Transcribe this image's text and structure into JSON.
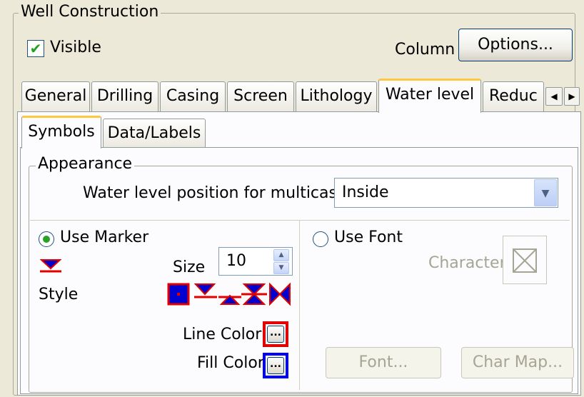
{
  "group": {
    "title": "Well Construction"
  },
  "visible": {
    "label": "Visible",
    "checked": true
  },
  "column": {
    "label": "Column",
    "options_button": "Options..."
  },
  "tabs": [
    {
      "label": "General",
      "active": false
    },
    {
      "label": "Drilling",
      "active": false
    },
    {
      "label": "Casing",
      "active": false
    },
    {
      "label": "Screen",
      "active": false
    },
    {
      "label": "Lithology",
      "active": false
    },
    {
      "label": "Water level",
      "active": true
    },
    {
      "label": "Reduc",
      "active": false
    }
  ],
  "subtabs": [
    {
      "label": "Symbols",
      "active": true
    },
    {
      "label": "Data/Labels",
      "active": false
    }
  ],
  "appearance": {
    "title": "Appearance",
    "position_label": "Water level position for multicasing",
    "position_value": "Inside"
  },
  "marker": {
    "use_marker_label": "Use Marker",
    "selected": true,
    "size_label": "Size",
    "size_value": "10",
    "style_label": "Style",
    "line_color_label": "Line Color",
    "fill_color_label": "Fill Color",
    "line_color": "#e00000",
    "fill_color": "#0000e0",
    "ellipsis": "..."
  },
  "font_section": {
    "use_font_label": "Use Font",
    "selected": false,
    "character_label": "Character",
    "font_button": "Font...",
    "char_map_button": "Char Map..."
  }
}
